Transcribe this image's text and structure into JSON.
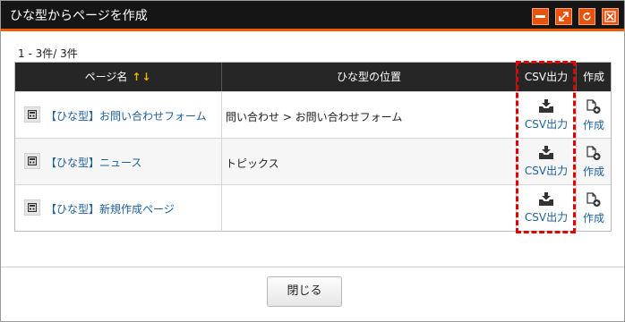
{
  "window": {
    "title": "ひな型からページを作成",
    "buttons": [
      "minimize-icon",
      "maximize-icon",
      "refresh-icon",
      "close-icon"
    ],
    "accent_color": "#f05a00"
  },
  "count_text": "1 - 3件/ 3件",
  "table": {
    "headers": {
      "name": "ページ名",
      "sort": "↑↓",
      "location": "ひな型の位置",
      "csv": "CSV出力",
      "create": "作成"
    },
    "rows": [
      {
        "name": "【ひな型】お問い合わせフォーム",
        "location": "問い合わせ > お問い合わせフォーム",
        "csv": "CSV出力",
        "create": "作成"
      },
      {
        "name": "【ひな型】ニュース",
        "location": "トピックス",
        "csv": "CSV出力",
        "create": "作成"
      },
      {
        "name": "【ひな型】新規作成ページ",
        "location": "",
        "csv": "CSV出力",
        "create": "作成"
      }
    ]
  },
  "footer": {
    "close_label": "閉じる"
  },
  "highlight_color": "#e00000"
}
